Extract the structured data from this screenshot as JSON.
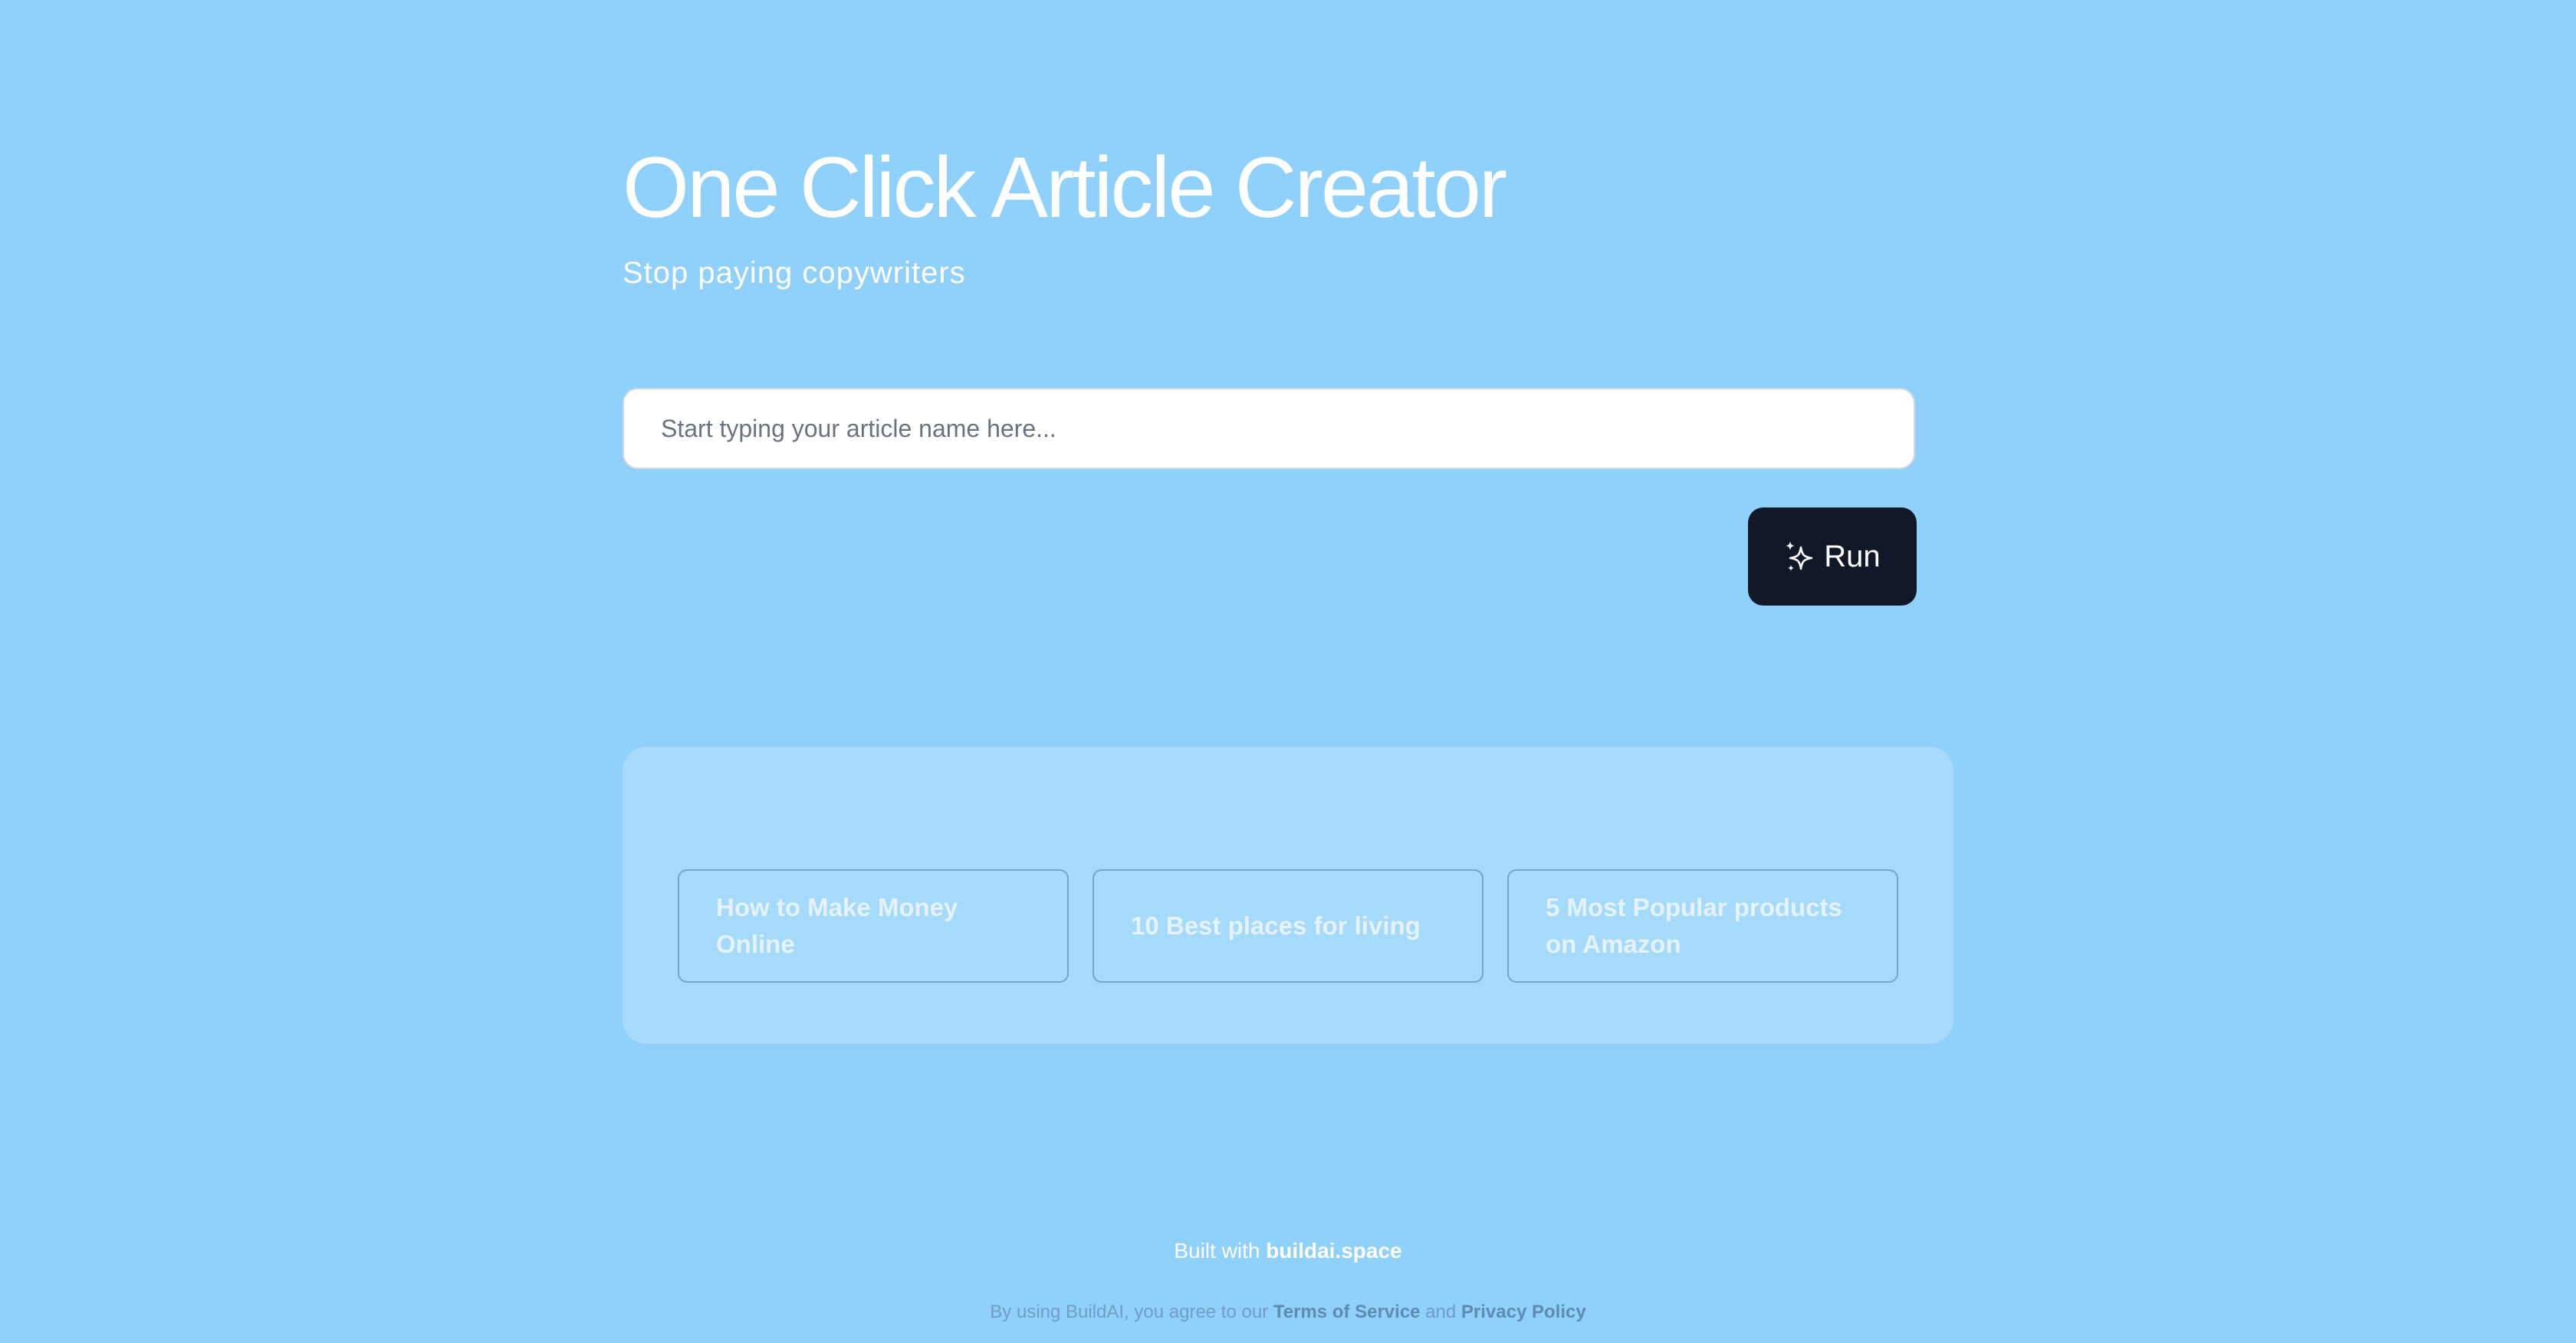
{
  "header": {
    "title": "One Click Article Creator",
    "subtitle": "Stop paying copywriters"
  },
  "input": {
    "placeholder": "Start typing your article name here...",
    "value": ""
  },
  "run_button": {
    "label": "Run",
    "icon": "sparkles-icon"
  },
  "suggestions": [
    {
      "label": "How to Make Money Online"
    },
    {
      "label": "10 Best places for living"
    },
    {
      "label": "5 Most Popular products on Amazon"
    }
  ],
  "footer": {
    "built_prefix": "Built with",
    "built_link": "buildai.space",
    "legal_prefix": "By using BuildAI, you agree to our",
    "terms_link": "Terms of Service",
    "legal_and": "and",
    "privacy_link": "Privacy Policy"
  },
  "colors": {
    "background": "#8fd1fb",
    "panel": "#a5dafb",
    "button": "#111827",
    "text_white": "#ffffff"
  }
}
